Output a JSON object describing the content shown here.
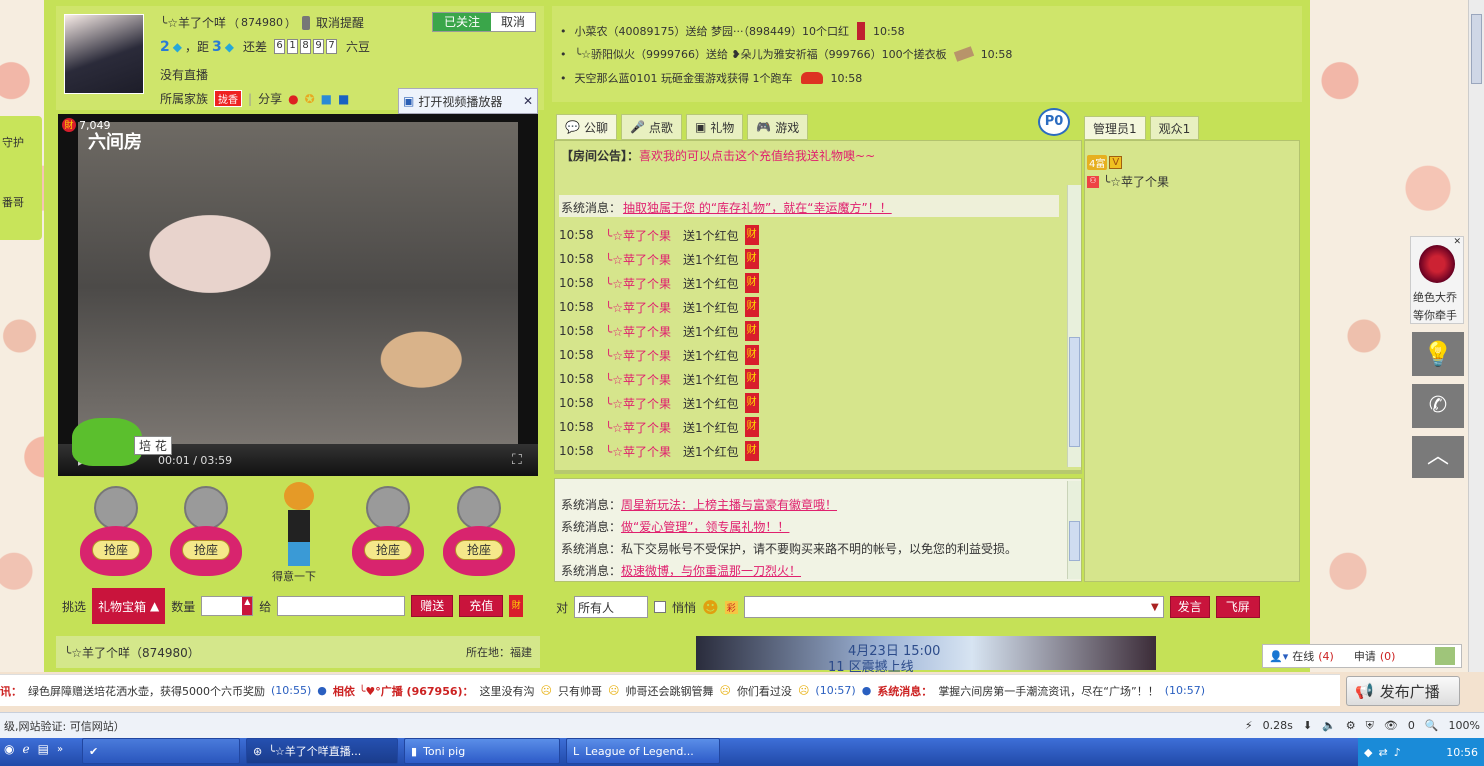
{
  "streamer": {
    "name": "╰☆羊了个咩",
    "id": "874980",
    "cancel_reminder": "取消提醒",
    "follow_label": "已关注",
    "cancel_label": "取消",
    "level1": "2",
    "distance_label": "，距",
    "level2": "3",
    "still_diff": "还差",
    "diff_digits": [
      "6",
      "1",
      "8",
      "9",
      "7"
    ],
    "diff_unit": "六豆",
    "no_stream": "没有直播",
    "family_label": "所属家族",
    "family_badge": "拢香",
    "share_label": "分享",
    "open_player": "打开视频播放器"
  },
  "video": {
    "logo": "六间房",
    "viewers": "7,049",
    "time": "00:01 / 03:59",
    "flower_label": "培 花"
  },
  "seats": [
    {
      "label": "抢座"
    },
    {
      "label": "抢座"
    },
    {
      "label": "得意一下"
    },
    {
      "label": "抢座"
    },
    {
      "label": "抢座"
    }
  ],
  "gift_bar": {
    "pick_label": "挑选",
    "box_label": "礼物宝箱",
    "qty_label": "数量",
    "to_label": "给",
    "send_label": "赠送",
    "recharge_label": "充值"
  },
  "footer_left": {
    "name": "╰☆羊了个咩（874980）",
    "location": "所在地：福建"
  },
  "gift_feed": [
    {
      "text": "小菜农（40089175）送给 梦园···（898449）10个口红",
      "time": "10:58"
    },
    {
      "text": "╰☆骄阳似火（9999766）送给 ❥朵儿为雅安祈福（999766）100个搓衣板",
      "time": "10:58"
    },
    {
      "text": "天空那么蓝0101 玩砸金蛋游戏获得 1个跑车",
      "time": "10:58"
    }
  ],
  "chat_tabs": [
    {
      "label": "公聊",
      "icon": "chat-icon"
    },
    {
      "label": "点歌",
      "icon": "mic-icon"
    },
    {
      "label": "礼物",
      "icon": "gift-icon"
    },
    {
      "label": "游戏",
      "icon": "gamepad-icon"
    }
  ],
  "parking_badge": "P0",
  "announcement": {
    "label": "【房间公告】：",
    "text": "喜欢我的可以点击这个充值给我送礼物噢~~"
  },
  "system_top": {
    "label": "系统消息：",
    "text": "抽取独属于您 的“库存礼物”，就在“幸运魔方”！！"
  },
  "chat_messages": [
    {
      "time": "10:58",
      "user": "╰☆苹了个果",
      "action": "送1个红包"
    },
    {
      "time": "10:58",
      "user": "╰☆苹了个果",
      "action": "送1个红包"
    },
    {
      "time": "10:58",
      "user": "╰☆苹了个果",
      "action": "送1个红包"
    },
    {
      "time": "10:58",
      "user": "╰☆苹了个果",
      "action": "送1个红包"
    },
    {
      "time": "10:58",
      "user": "╰☆苹了个果",
      "action": "送1个红包"
    },
    {
      "time": "10:58",
      "user": "╰☆苹了个果",
      "action": "送1个红包"
    },
    {
      "time": "10:58",
      "user": "╰☆苹了个果",
      "action": "送1个红包"
    },
    {
      "time": "10:58",
      "user": "╰☆苹了个果",
      "action": "送1个红包"
    },
    {
      "time": "10:58",
      "user": "╰☆苹了个果",
      "action": "送1个红包"
    },
    {
      "time": "10:58",
      "user": "╰☆苹了个果",
      "action": "送1个红包"
    }
  ],
  "cai_label": "财",
  "system_messages": [
    {
      "label": "系统消息：",
      "text": "周星新玩法：上榜主播与富豪有徽章哦！",
      "link": true
    },
    {
      "label": "系统消息：",
      "text": "做“爱心管理”，领专属礼物！！",
      "link": true
    },
    {
      "label": "系统消息：",
      "text": "私下交易帐号不受保护，请不要购买来路不明的帐号，以免您的利益受损。",
      "link": false
    },
    {
      "label": "系统消息：",
      "text": "极速微博，与你重温那一刀烈火！",
      "link": true
    }
  ],
  "chat_input": {
    "to_label": "对",
    "target": "所有人",
    "whisper": "悄悄",
    "speak": "发言",
    "flyscreen": "飞屏"
  },
  "user_tabs": [
    {
      "label": "管理员1"
    },
    {
      "label": "观众1"
    }
  ],
  "user_list": [
    {
      "badge1": "4富",
      "badge2": "V",
      "name": "╰☆苹了个果"
    }
  ],
  "left_edge": {
    "guard": "守护",
    "other": "番哥"
  },
  "right_ad": {
    "line1": "绝色大乔",
    "line2": "等你牵手"
  },
  "banner": {
    "date": "4月23日 15:00",
    "text": "11 区震撼上线"
  },
  "online": {
    "online_label": "在线",
    "online_count": "(4)",
    "apply_label": "申请",
    "apply_count": "(0)"
  },
  "ticker": [
    {
      "label": "讯：",
      "text": "绿色屏障赠送培花洒水壶，获得5000个六币奖励",
      "time": "(10:55)"
    },
    {
      "label": "相依 ╰♥°广播 (967956)：",
      "text": "这里没有沟",
      "extra": "只有帅哥",
      "extra2": "帅哥还会跳钢管舞",
      "extra3": "你们看过没",
      "time": "(10:57)"
    },
    {
      "label": "系统消息：",
      "text": "掌握六间房第一手潮流资讯，尽在“广场”！！",
      "time": "(10:57)"
    }
  ],
  "broadcast_button": "发布广播",
  "status_bar": {
    "left": "级,网站验证: 可信网站）",
    "speed": "0.28s",
    "badge0": "0",
    "zoom": "100%"
  },
  "taskbar": {
    "items": [
      {
        "label": "╰☆羊了个咩直播..."
      },
      {
        "label": "Toni pig"
      },
      {
        "label": "League of Legend..."
      }
    ],
    "clock": "10:56"
  }
}
